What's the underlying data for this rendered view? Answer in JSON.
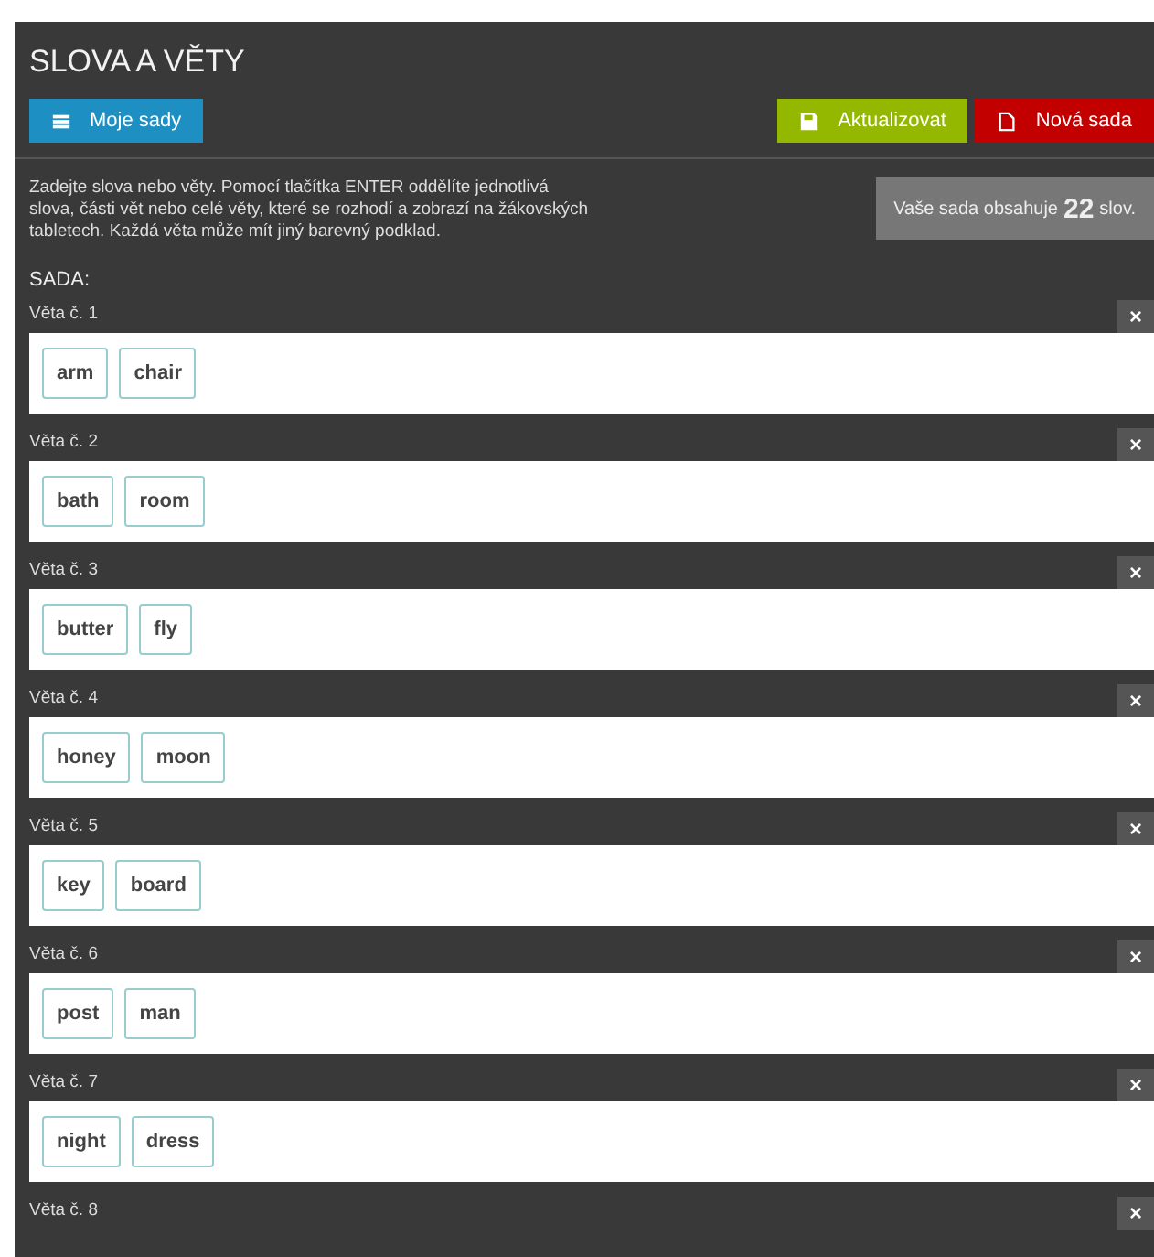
{
  "title": "SLOVA A VĚTY",
  "toolbar": {
    "left_button": "Moje sady",
    "right_buttons": [
      {
        "kind": "save",
        "label": "Aktualizovat"
      },
      {
        "kind": "new",
        "label": "Nová sada"
      }
    ]
  },
  "instructions": "Zadejte slova nebo věty. Pomocí tlačítka ENTER oddělíte jednotlivá slova, části vět nebo celé věty, které se rozhodí a zobrazí na žákovských tabletech. Každá věta může mít jiný barevný podklad.",
  "count_info": {
    "before": "Vaše sada obsahuje",
    "count": "22",
    "after": "slov."
  },
  "set_label": "SADA:",
  "sentences": [
    {
      "label": "Věta č. 1",
      "close": "×",
      "words": [
        "arm",
        "chair"
      ]
    },
    {
      "label": "Věta č. 2",
      "close": "×",
      "words": [
        "bath",
        "room"
      ]
    },
    {
      "label": "Věta č. 3",
      "close": "×",
      "words": [
        "butter",
        "fly"
      ]
    },
    {
      "label": "Věta č. 4",
      "close": "×",
      "words": [
        "honey",
        "moon"
      ]
    },
    {
      "label": "Věta č. 5",
      "close": "×",
      "words": [
        "key",
        "board"
      ]
    },
    {
      "label": "Věta č. 6",
      "close": "×",
      "words": [
        "post",
        "man"
      ]
    },
    {
      "label": "Věta č. 7",
      "close": "×",
      "words": [
        "night",
        "dress"
      ]
    },
    {
      "label": "Věta č. 8",
      "close": "×"
    }
  ]
}
